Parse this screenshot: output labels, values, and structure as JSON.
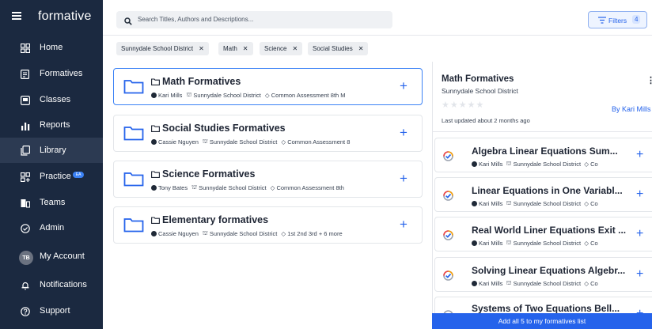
{
  "sidebar": {
    "logo": "formative",
    "items": [
      {
        "label": "Home",
        "icon": "grid-icon"
      },
      {
        "label": "Formatives",
        "icon": "document-icon"
      },
      {
        "label": "Classes",
        "icon": "book-icon"
      },
      {
        "label": "Reports",
        "icon": "bar-chart-icon"
      },
      {
        "label": "Library",
        "icon": "copy-icon",
        "active": true
      },
      {
        "label": "Practice",
        "icon": "grid-plus-icon",
        "badge": "EA"
      },
      {
        "label": "Teams",
        "icon": "teams-icon"
      },
      {
        "label": "Admin",
        "icon": "check-circle-icon"
      },
      {
        "label": "My Account",
        "avatar_initials": "TB"
      },
      {
        "label": "Notifications",
        "icon": "bell-icon"
      },
      {
        "label": "Support",
        "icon": "help-icon"
      }
    ]
  },
  "search": {
    "placeholder": "Search Titles, Authors and Descriptions..."
  },
  "filters": {
    "label": "Filters",
    "count": "4"
  },
  "chips": [
    "Sunnydale School District",
    "Math",
    "Science",
    "Social Studies"
  ],
  "folders": [
    {
      "title": "Math Formatives",
      "author": "Kari Mills",
      "district": "Sunnydale School District",
      "tags": "Common Assessment  8th  M"
    },
    {
      "title": "Social Studies Formatives",
      "author": "Cassie Nguyen",
      "district": "Sunnydale School District",
      "tags": "Common Assessment  8"
    },
    {
      "title": "Science Formatives",
      "author": "Tony Bates",
      "district": "Sunnydale School District",
      "tags": "Common Assessment  8th"
    },
    {
      "title": "Elementary formatives",
      "author": "Cassie Nguyen",
      "district": "Sunnydale School District",
      "tags": "1st  2nd  3rd  + 6 more"
    }
  ],
  "detail": {
    "title": "Math Formatives",
    "subtitle": "Sunnydale School District",
    "stars": "★★★★★",
    "by": "By Kari Mills",
    "updated": "Last updated about 2 months ago",
    "formatives": [
      {
        "title": "Algebra Linear Equations Sum...",
        "author": "Kari Mills",
        "district": "Sunnydale School District",
        "tag": "Co"
      },
      {
        "title": "Linear Equations in One Variabl...",
        "author": "Kari Mills",
        "district": "Sunnydale School District",
        "tag": "Co"
      },
      {
        "title": "Real World Liner Equations Exit ...",
        "author": "Kari Mills",
        "district": "Sunnydale School District",
        "tag": "Co"
      },
      {
        "title": "Solving Linear Equations Algebr...",
        "author": "Kari Mills",
        "district": "Sunnydale School District",
        "tag": "Co"
      },
      {
        "title": "Systems of Two Equations Bell...",
        "author": "",
        "district": "",
        "tag": ""
      }
    ],
    "add_all_label": "Add all 5 to my formatives list"
  },
  "colors": {
    "sidebar": "#1b2940",
    "accent": "#2563eb"
  }
}
